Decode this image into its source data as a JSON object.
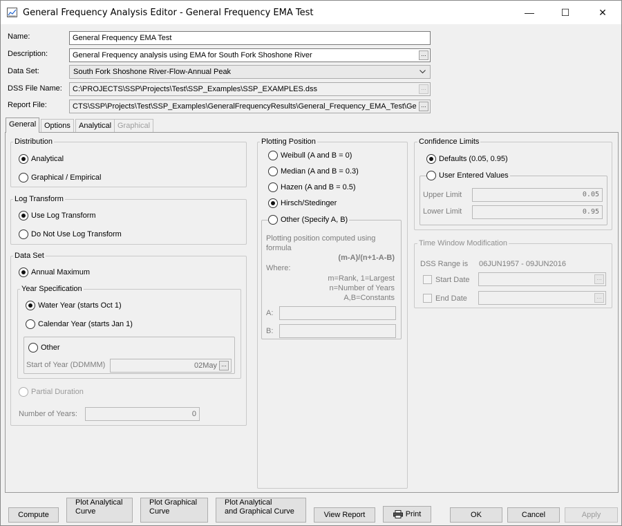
{
  "window": {
    "title": "General Frequency Analysis Editor - General Frequency EMA Test",
    "minimize_glyph": "—",
    "maximize_glyph": "☐",
    "close_glyph": "✕"
  },
  "form": {
    "name_label": "Name:",
    "name_value": "General Frequency EMA Test",
    "description_label": "Description:",
    "description_value": "General Frequency analysis using EMA for South Fork Shoshone River",
    "dataset_label": "Data Set:",
    "dataset_value": "South Fork Shoshone River-Flow-Annual Peak",
    "dss_label": "DSS File Name:",
    "dss_value": "C:\\PROJECTS\\SSP\\Projects\\Test\\SSP_Examples\\SSP_EXAMPLES.dss",
    "report_label": "Report File:",
    "report_value": "CTS\\SSP\\Projects\\Test\\SSP_Examples\\GeneralFrequencyResults\\General_Frequency_EMA_Test\\Ge",
    "ellipsis": "..."
  },
  "tabs": [
    {
      "label": "General"
    },
    {
      "label": "Options"
    },
    {
      "label": "Analytical"
    },
    {
      "label": "Graphical"
    }
  ],
  "distribution": {
    "title": "Distribution",
    "analytical": "Analytical",
    "graphical": "Graphical / Empirical"
  },
  "log_transform": {
    "title": "Log Transform",
    "use": "Use Log Transform",
    "no_use": "Do Not Use Log Transform"
  },
  "data_set": {
    "title": "Data Set",
    "annual_max": "Annual Maximum",
    "year_spec_title": "Year Specification",
    "water_year": "Water Year (starts Oct 1)",
    "calendar_year": "Calendar Year (starts Jan 1)",
    "other": "Other",
    "start_of_year_label": "Start of Year (DDMMM)",
    "start_of_year_value": "02May",
    "partial_duration": "Partial Duration",
    "num_years_label": "Number of Years:",
    "num_years_value": "0"
  },
  "plotting_position": {
    "title": "Plotting Position",
    "weibull": "Weibull (A and B = 0)",
    "median": "Median (A and B = 0.3)",
    "hazen": "Hazen (A and B = 0.5)",
    "hirsch": "Hirsch/Stedinger",
    "other": "Other (Specify A, B)",
    "desc1": "Plotting position computed using",
    "desc2": "formula",
    "formula": "(m-A)/(n+1-A-B)",
    "where": "Where:",
    "def1": "m=Rank, 1=Largest",
    "def2": "n=Number of Years",
    "def3": "A,B=Constants",
    "a_label": "A:",
    "b_label": "B:"
  },
  "confidence": {
    "title": "Confidence Limits",
    "defaults": "Defaults (0.05, 0.95)",
    "user": "User Entered Values",
    "upper_label": "Upper Limit",
    "upper_value": "0.05",
    "lower_label": "Lower Limit",
    "lower_value": "0.95"
  },
  "time_window": {
    "title": "Time Window Modification",
    "range_label": "DSS Range is",
    "range_value": "06JUN1957 - 09JUN2016",
    "start_label": "Start Date",
    "end_label": "End Date"
  },
  "buttons": {
    "compute": "Compute",
    "plot_analytical_1": "Plot Analytical",
    "plot_analytical_2": "Curve",
    "plot_graphical_1": "Plot Graphical",
    "plot_graphical_2": "Curve",
    "plot_both_1": "Plot Analytical",
    "plot_both_2": "and Graphical Curve",
    "view_report": "View Report",
    "print": "Print",
    "ok": "OK",
    "cancel": "Cancel",
    "apply": "Apply"
  }
}
